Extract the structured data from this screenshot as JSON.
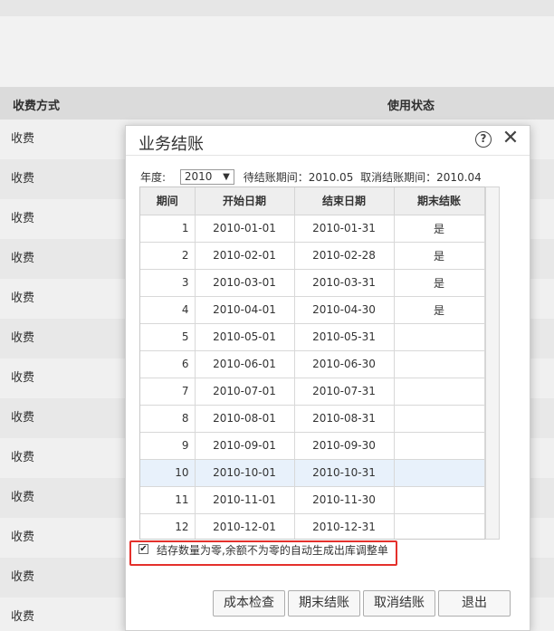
{
  "background": {
    "header": {
      "col1": "收费方式",
      "col2": "使用状态"
    },
    "rows": [
      "收费",
      "收费",
      "收费",
      "收费",
      "收费",
      "收费",
      "收费",
      "收费",
      "收费",
      "收费",
      "收费",
      "收费",
      "收费"
    ]
  },
  "dialog": {
    "title": "业务结账",
    "help_icon": "?",
    "close_icon": "✕",
    "year_label": "年度:",
    "year_value": "2010",
    "pending_period": "待结账期间：2010.05",
    "cancel_period": "取消结账期间：2010.04",
    "table": {
      "headers": [
        "期间",
        "开始日期",
        "结束日期",
        "期末结账"
      ],
      "rows": [
        [
          "1",
          "2010-01-01",
          "2010-01-31",
          "是"
        ],
        [
          "2",
          "2010-02-01",
          "2010-02-28",
          "是"
        ],
        [
          "3",
          "2010-03-01",
          "2010-03-31",
          "是"
        ],
        [
          "4",
          "2010-04-01",
          "2010-04-30",
          "是"
        ],
        [
          "5",
          "2010-05-01",
          "2010-05-31",
          ""
        ],
        [
          "6",
          "2010-06-01",
          "2010-06-30",
          ""
        ],
        [
          "7",
          "2010-07-01",
          "2010-07-31",
          ""
        ],
        [
          "8",
          "2010-08-01",
          "2010-08-31",
          ""
        ],
        [
          "9",
          "2010-09-01",
          "2010-09-30",
          ""
        ],
        [
          "10",
          "2010-10-01",
          "2010-10-31",
          ""
        ],
        [
          "11",
          "2010-11-01",
          "2010-11-30",
          ""
        ],
        [
          "12",
          "2010-12-01",
          "2010-12-31",
          ""
        ]
      ],
      "selected_row": 10
    },
    "checkbox_label": "结存数量为零,余额不为零的自动生成出库调整单",
    "checkbox_checked": true,
    "buttons": {
      "cost_check": "成本检查",
      "period_close": "期末结账",
      "cancel_close": "取消结账",
      "exit": "退出"
    }
  },
  "colors": {
    "highlight_border": "#e4302b",
    "selected_row": "#e8f1fb"
  }
}
